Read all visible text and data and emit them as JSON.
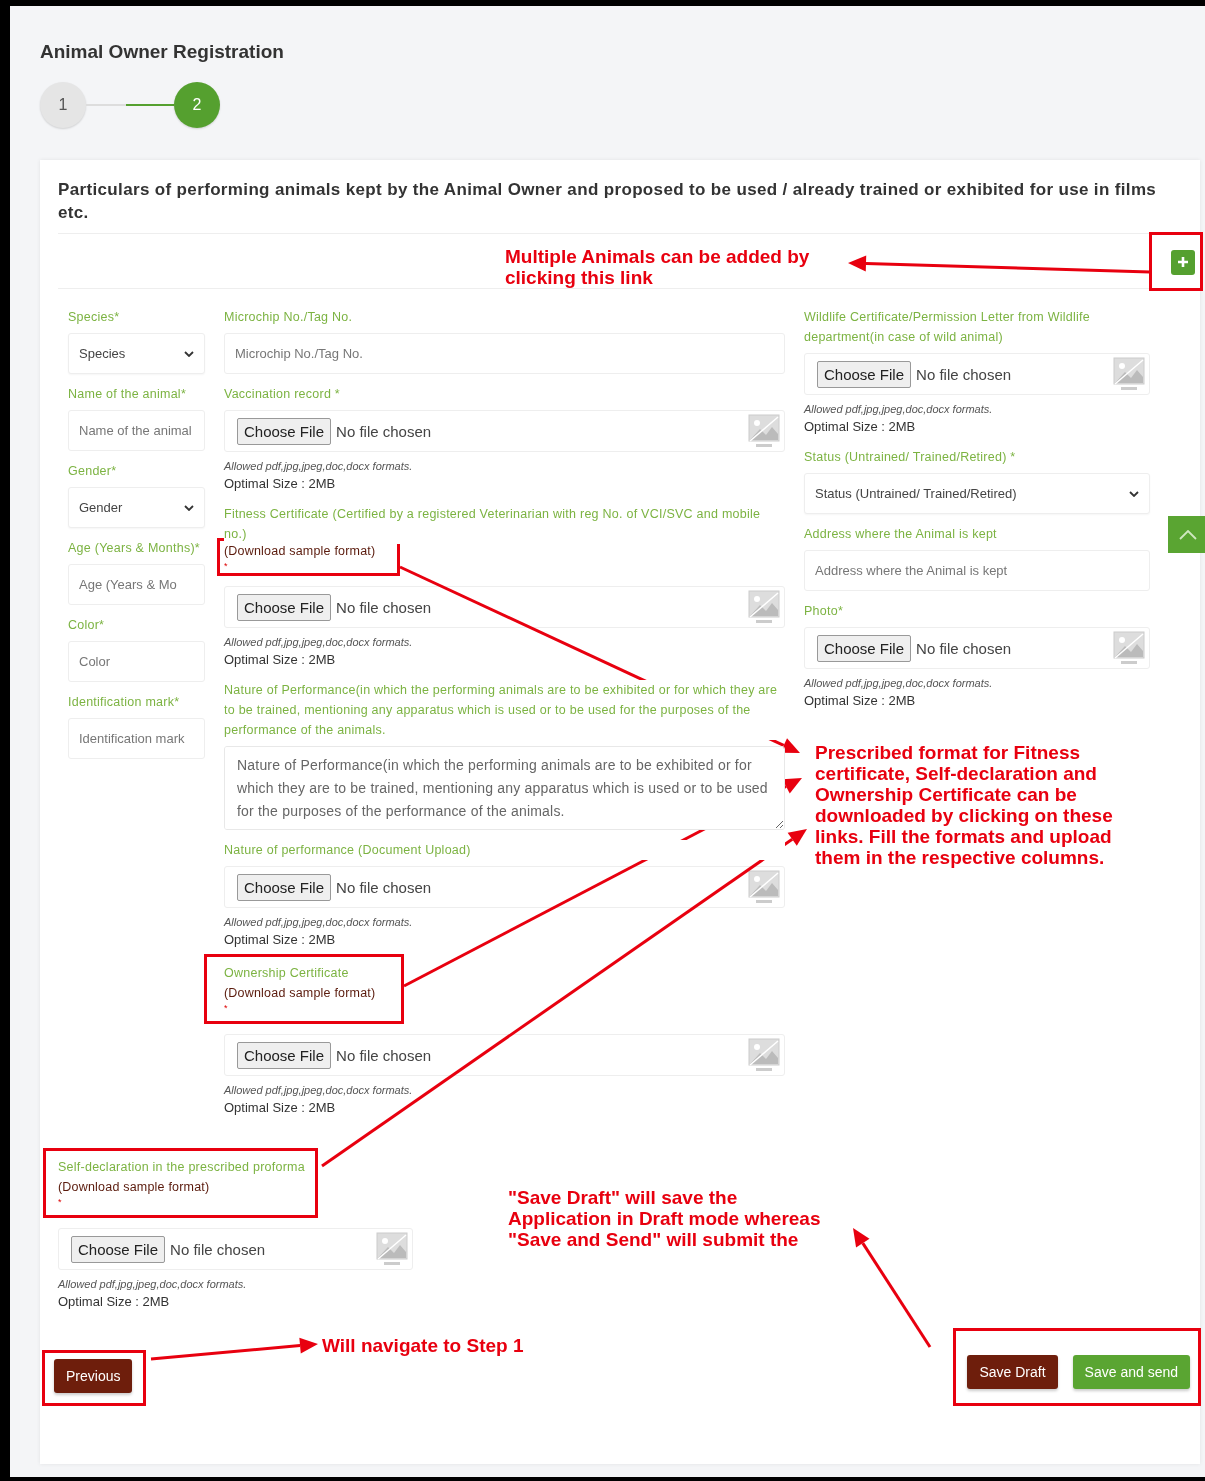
{
  "page": {
    "title": "Animal Owner Registration"
  },
  "steps": [
    {
      "label": "1",
      "selected": false
    },
    {
      "label": "2",
      "selected": true
    }
  ],
  "form": {
    "heading": "Particulars of performing animals kept by the Animal Owner and proposed to be used / already trained or exhibited for use in films etc.",
    "columns": [
      [
        {
          "kind": "select",
          "label": "Species*",
          "placeholder": "Species"
        },
        {
          "kind": "input",
          "label": "Name of the animal*",
          "placeholder": "Name of the animal"
        },
        {
          "kind": "select",
          "label": "Gender*",
          "placeholder": "Gender"
        },
        {
          "kind": "input",
          "label": "Age (Years & Months)*",
          "placeholder": "Age (Years & Mo"
        },
        {
          "kind": "input",
          "label": "Color*",
          "placeholder": "Color"
        },
        {
          "kind": "input",
          "label": "Identification mark*",
          "placeholder": "Identification mark"
        }
      ],
      [
        {
          "kind": "input",
          "label": "Microchip No./Tag No.",
          "placeholder": "Microchip No./Tag No."
        },
        {
          "kind": "file",
          "label": "Vaccination record *",
          "button": "Choose File",
          "status": "No file chosen",
          "hint": "Allowed pdf,jpg,jpeg,doc,docx formats.",
          "size": "Optimal Size : 2MB"
        },
        {
          "kind": "file",
          "label": "Fitness Certificate (Certified by a registered Veterinarian with reg No. of VCI/SVC and mobile no.)",
          "link": "(Download sample format)",
          "mark": "*",
          "highlight_link": true,
          "button": "Choose File",
          "status": "No file chosen",
          "hint": "Allowed pdf,jpg,jpeg,doc,docx formats.",
          "size": "Optimal Size : 2MB"
        },
        {
          "kind": "textarea",
          "label": "Nature of Performance(in which the performing animals are to be exhibited or for which they are to be trained, mentioning any apparatus which is used or to be used for the purposes of the performance of the animals.",
          "placeholder": "Nature of Performance(in which the performing animals are to be exhibited or for which they are to be trained, mentioning any apparatus which is used or to be used for the purposes of the performance of the animals."
        },
        {
          "kind": "file",
          "label": "Nature of performance (Document Upload)",
          "button": "Choose File",
          "status": "No file chosen",
          "hint": "Allowed pdf,jpg,jpeg,doc,docx formats.",
          "size": "Optimal Size : 2MB"
        },
        {
          "kind": "file",
          "label": "Ownership Certificate",
          "link": "(Download sample format)",
          "mark": "*",
          "highlight_label": true,
          "button": "Choose File",
          "status": "No file chosen",
          "hint": "Allowed pdf,jpg,jpeg,doc,docx formats.",
          "size": "Optimal Size : 2MB"
        }
      ],
      [
        {
          "kind": "file",
          "label": "Wildlife Certificate/Permission Letter from Wildlife department(in case of wild animal)",
          "button": "Choose File",
          "status": "No file chosen",
          "hint": "Allowed pdf,jpg,jpeg,doc,docx formats.",
          "size": "Optimal Size : 2MB"
        },
        {
          "kind": "select",
          "label": "Status (Untrained/ Trained/Retired) *",
          "placeholder": "Status (Untrained/ Trained/Retired)"
        },
        {
          "kind": "input",
          "label": "Address where the Animal is kept",
          "placeholder": "Address where the Animal is kept"
        },
        {
          "kind": "file",
          "label": "Photo*",
          "button": "Choose File",
          "status": "No file chosen",
          "hint": "Allowed pdf,jpg,jpeg,doc,docx formats.",
          "size": "Optimal Size : 2MB"
        }
      ]
    ],
    "extra": [
      {
        "kind": "file",
        "label": "Self-declaration in the prescribed proforma",
        "link": "(Download sample format)",
        "mark": "*",
        "highlight_label": true,
        "button": "Choose File",
        "status": "No file chosen",
        "hint": "Allowed pdf,jpg,jpeg,doc,docx formats.",
        "size": "Optimal Size : 2MB"
      }
    ]
  },
  "buttons": [
    {
      "kind": "previous",
      "label": "Previous"
    },
    {
      "kind": "draft",
      "label": "Save Draft"
    },
    {
      "kind": "send",
      "label": "Save and send"
    }
  ],
  "annotations": [
    {
      "text": "Multiple Animals can be added by\nclicking this link"
    },
    {
      "text": "Prescribed format for Fitness\ncertificate, Self-declaration and\nOwnership Certificate can be\ndownloaded by clicking on these\nlinks. Fill the formats and upload\nthem in the respective columns."
    },
    {
      "text": "\"Save Draft\" will save the\nApplication in Draft mode whereas\n\"Save and Send\" will submit the"
    },
    {
      "text": "Will navigate to Step 1"
    }
  ]
}
